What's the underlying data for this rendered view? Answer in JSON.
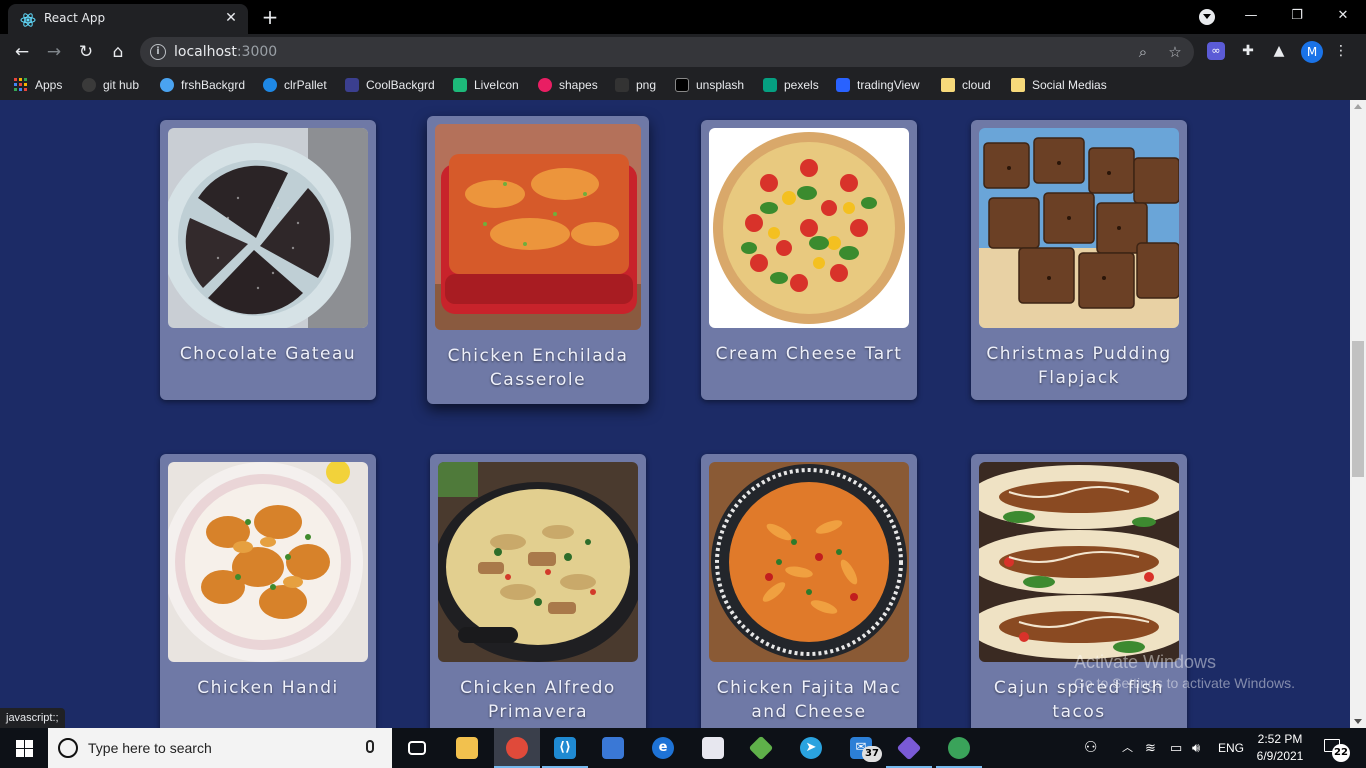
{
  "browser": {
    "tab_title": "React App",
    "tab_close": "✕",
    "new_tab": "+",
    "url_host": "localhost",
    "url_port": ":3000",
    "status_text": "javascript:;",
    "window_controls": {
      "minimize": "—",
      "restore": "❐",
      "close": "✕"
    },
    "avatar_letter": "M"
  },
  "bookmarks": [
    {
      "label": "Apps",
      "icon": "apps-grid-icon",
      "color": "#e8453c"
    },
    {
      "label": "git hub",
      "icon": "github-icon",
      "color": "#24292e"
    },
    {
      "label": "frshBackgrd",
      "icon": "bubble-icon",
      "color": "#4aa3f0"
    },
    {
      "label": "clrPallet",
      "icon": "circle-c-icon",
      "color": "#1e88e5"
    },
    {
      "label": "CoolBackgrd",
      "icon": "coolbg-icon",
      "color": "#3b3f8f"
    },
    {
      "label": "LiveIcon",
      "icon": "liveicon-icon",
      "color": "#1db97a"
    },
    {
      "label": "shapes",
      "icon": "shapes-b-icon",
      "color": "#e91e63"
    },
    {
      "label": "png",
      "icon": "png-icon",
      "color": "#333333"
    },
    {
      "label": "unsplash",
      "icon": "unsplash-icon",
      "color": "#000000"
    },
    {
      "label": "pexels",
      "icon": "pexels-icon",
      "color": "#05a081"
    },
    {
      "label": "tradingView",
      "icon": "tradingview-icon",
      "color": "#2962ff"
    },
    {
      "label": "cloud",
      "icon": "folder-icon",
      "color": "#f6d97a"
    },
    {
      "label": "Social Medias",
      "icon": "folder-icon",
      "color": "#f6d97a"
    }
  ],
  "recipes": [
    {
      "name": "Chocolate Gateau"
    },
    {
      "name": "Chicken Enchilada Casserole"
    },
    {
      "name": "Cream Cheese Tart"
    },
    {
      "name": "Christmas Pudding Flapjack"
    },
    {
      "name": "Chicken Handi"
    },
    {
      "name": "Chicken Alfredo Primavera"
    },
    {
      "name": "Chicken Fajita Mac and Cheese"
    },
    {
      "name": "Cajun spiced fish tacos"
    }
  ],
  "watermark": {
    "line1": "Activate Windows",
    "line2": "Go to Settings to activate Windows."
  },
  "taskbar": {
    "search_placeholder": "Type here to search",
    "mail_badge": "37",
    "language": "ENG",
    "time": "2:52 PM",
    "date": "6/9/2021",
    "notification_count": "22"
  },
  "colors": {
    "page_background": "#1c2b66",
    "card_background": "#6f79a6",
    "card_text": "#eef0fa"
  }
}
